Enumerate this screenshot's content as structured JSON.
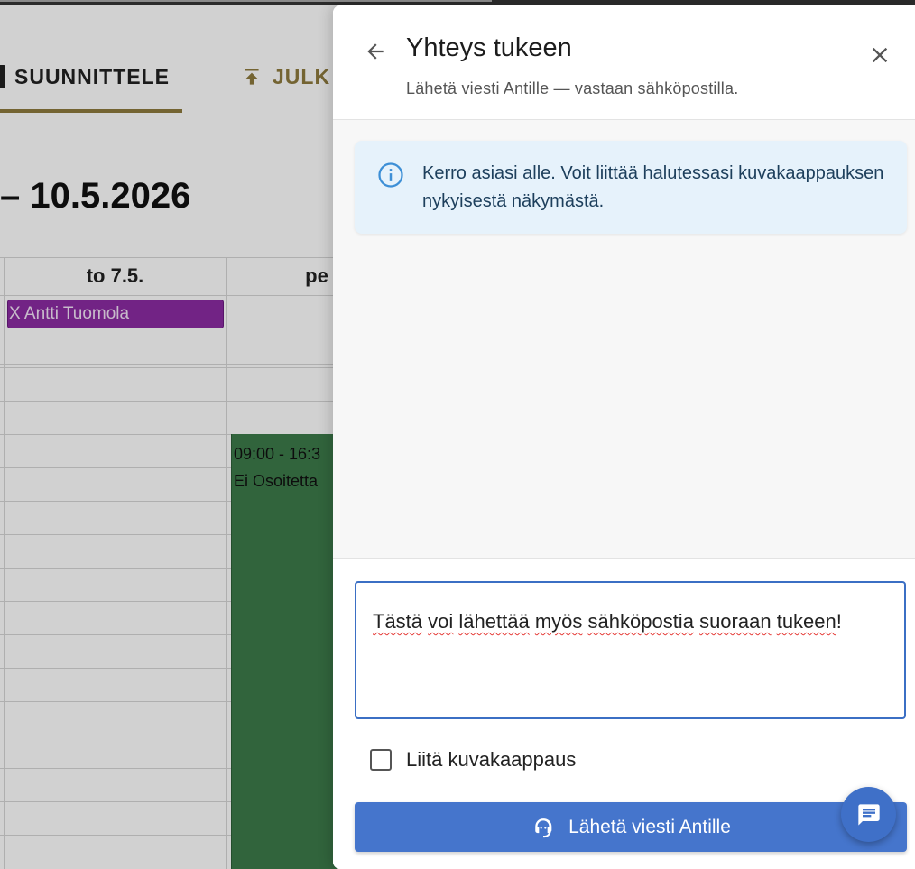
{
  "background": {
    "tabs": [
      {
        "label": "SUUNNITTELE",
        "active": true
      },
      {
        "label": "JULK",
        "active": false
      }
    ],
    "date_range": "– 10.5.2026",
    "day_headers": [
      "to 7.5.",
      "pe"
    ],
    "allday_event": "X Antti Tuomola",
    "event": {
      "time": "09:00 - 16:3",
      "title": "Ei Osoitetta"
    }
  },
  "drawer": {
    "title": "Yhteys tukeen",
    "subtitle": "Lähetä viesti Antille — vastaan sähköpostilla.",
    "info_text": "Kerro asiasi alle. Voit liittää halutessasi kuvakaappauksen nykyisestä näkymästä.",
    "message": {
      "words": [
        "Tästä",
        " ",
        "voi",
        " ",
        "lähettää",
        " ",
        "myös",
        " ",
        "sähköpostia",
        " ",
        "suoraan",
        " ",
        "tukeen",
        "!"
      ]
    },
    "attach_label": "Liitä kuvakaappaus",
    "attach_checked": false,
    "send_label": "Lähetä viesti Antille"
  },
  "colors": {
    "accent": "#4575cc",
    "gold": "#8e7a3e",
    "event_green": "#3c7a4a",
    "event_purple": "#8c2ba3",
    "info_bg": "#e6f2fb"
  }
}
